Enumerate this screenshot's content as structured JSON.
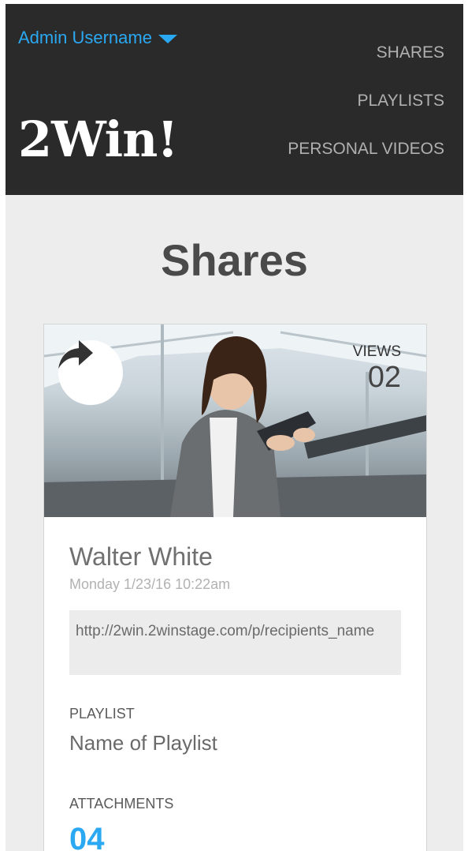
{
  "header": {
    "user_label": "Admin Username",
    "logo": "2Win!",
    "nav": [
      "SHARES",
      "PLAYLISTS",
      "PERSONAL VIDEOS"
    ]
  },
  "page": {
    "title": "Shares"
  },
  "share_card": {
    "views_label": "VIEWS",
    "views_count": "02",
    "recipient_name": "Walter White",
    "timestamp": "Monday 1/23/16 10:22am",
    "share_url": "http://2win.2winstage.com/p/recipients_name",
    "playlist_label": "PLAYLIST",
    "playlist_name": "Name of Playlist",
    "attachments_label": "ATTACHMENTS",
    "attachments_count": "04"
  },
  "colors": {
    "header_bg": "#2a2a2a",
    "accent": "#2aa8f2",
    "page_bg": "#ededed"
  },
  "icons": [
    "chevron-down-icon",
    "share-arrow-icon"
  ]
}
